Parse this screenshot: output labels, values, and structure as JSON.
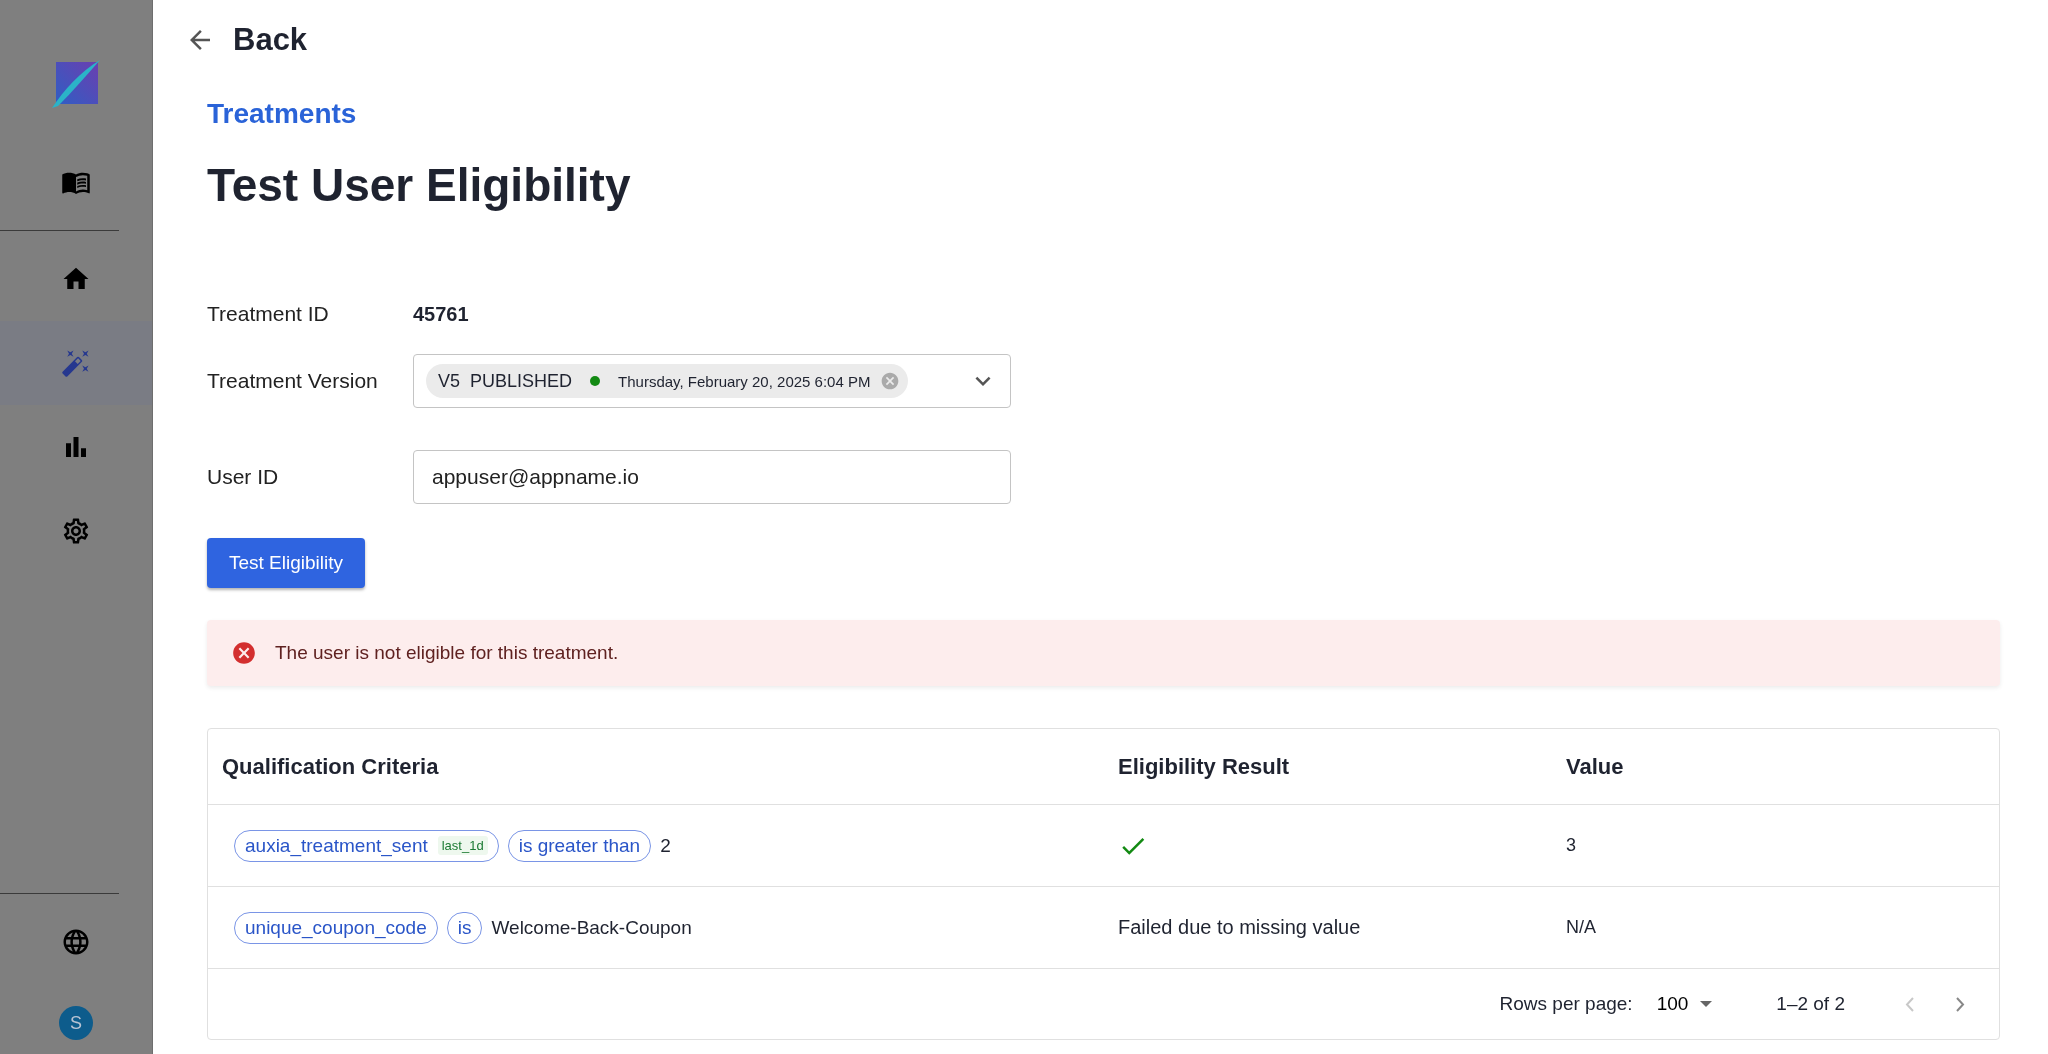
{
  "sidebar": {
    "items": [
      {
        "selected": false
      },
      {
        "selected": false
      },
      {
        "selected": true
      },
      {
        "selected": false
      },
      {
        "selected": false
      }
    ],
    "footer_items": [
      {
        "selected": false
      }
    ],
    "avatar": "S"
  },
  "back": "Back",
  "breadcrumb": "Treatments",
  "title": "Test User Eligibility",
  "form": {
    "treatment_id_label": "Treatment ID",
    "treatment_id": "45761",
    "version_label": "Treatment Version",
    "version_chip": {
      "version": "V5",
      "status": "PUBLISHED",
      "color": "#138a13",
      "date": "Thursday, February 20, 2025 6:04 PM"
    },
    "user_id_label": "User ID",
    "user_id": "appuser@appname.io"
  },
  "button": "Test Eligibility",
  "alert": "The user is not eligible for this treatment.",
  "table": {
    "columns": [
      "Qualification Criteria",
      "Eligibility Result",
      "Value"
    ],
    "rows": [
      {
        "criteria": {
          "chips": [
            {
              "text": "auxia_treatment_sent",
              "tag": "last_1d"
            },
            {
              "text": "is greater than"
            }
          ],
          "operand": "2"
        },
        "result": {
          "kind": "check"
        },
        "value": "3"
      },
      {
        "criteria": {
          "chips": [
            {
              "text": "unique_coupon_code"
            },
            {
              "text": "is"
            }
          ],
          "operand": "Welcome-Back-Coupon"
        },
        "result": {
          "kind": "text",
          "text": "Failed due to missing value"
        },
        "value": "N/A"
      }
    ],
    "footer": {
      "rows_per_page_label": "Rows per page:",
      "rows_per_page": "100",
      "range": "1–2 of 2",
      "prev_disabled": true,
      "next_disabled": false
    }
  }
}
